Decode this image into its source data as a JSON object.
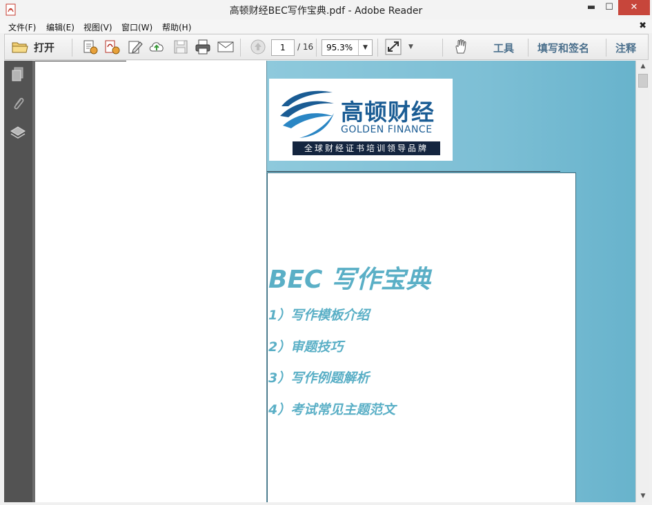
{
  "window": {
    "title": "高顿财经BEC写作宝典.pdf - Adobe Reader",
    "minimize": "▬",
    "maximize": "☐",
    "close": "✕"
  },
  "menu": {
    "items": [
      "文件(F)",
      "编辑(E)",
      "视图(V)",
      "窗口(W)",
      "帮助(H)"
    ],
    "close": "✖"
  },
  "toolbar": {
    "open_label": "打开",
    "page_current": "1",
    "page_total": "/ 16",
    "zoom": "95.3%",
    "tools": "工具",
    "fill_sign": "填写和签名",
    "comment": "注释"
  },
  "document": {
    "logo_cn": "高顿财经",
    "logo_en": "GOLDEN FINANCE",
    "logo_tagline": "全球财经证书培训领导品牌",
    "title": "BEC 写作宝典",
    "items": [
      "1）写作模板介绍",
      "2）审题技巧",
      "3）写作例题解析",
      "4）考试常见主题范文"
    ]
  },
  "colors": {
    "accent": "#5aafc6",
    "brand_blue": "#1a5c94",
    "panel_dark": "#535353"
  }
}
